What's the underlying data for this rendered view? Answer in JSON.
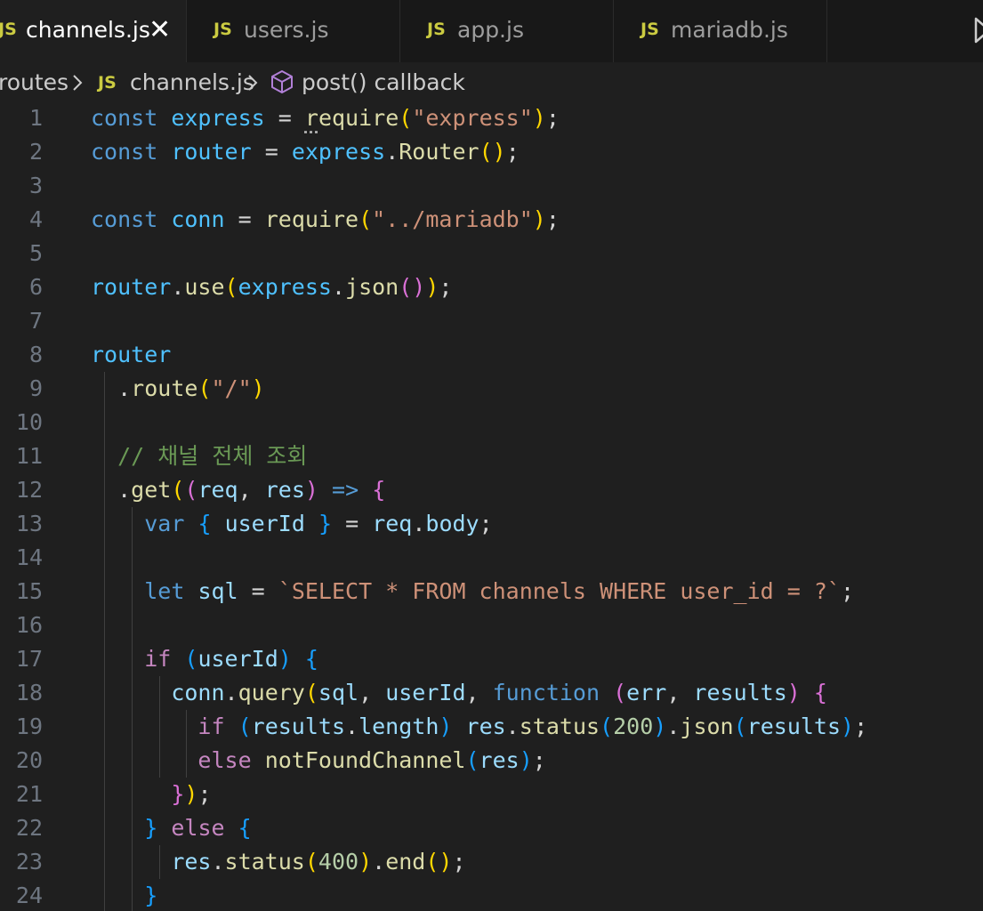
{
  "tabs": [
    {
      "icon": "JS",
      "label": "channels.js",
      "active": true,
      "close": "✕"
    },
    {
      "icon": "JS",
      "label": "users.js",
      "active": false
    },
    {
      "icon": "JS",
      "label": "app.js",
      "active": false
    },
    {
      "icon": "JS",
      "label": "mariadb.js",
      "active": false
    }
  ],
  "breadcrumb": {
    "folder": "routes",
    "file_icon": "JS",
    "file": "channels.js",
    "symbol_icon": "cube-icon",
    "symbol": "post() callback"
  },
  "line_numbers": [
    "1",
    "2",
    "3",
    "4",
    "5",
    "6",
    "7",
    "8",
    "9",
    "10",
    "11",
    "12",
    "13",
    "14",
    "15",
    "16",
    "17",
    "18",
    "19",
    "20",
    "21",
    "22",
    "23",
    "24"
  ],
  "code": {
    "l1": {
      "kw": "const",
      "v": "express",
      "eq": "=",
      "r": "r",
      "rest": "equire",
      "p1": "(",
      "s": "\"express\"",
      "p2": ")",
      "end": ";"
    },
    "l2": {
      "kw": "const",
      "v": "router",
      "eq": "=",
      "obj": "express",
      "fn": "Router",
      "p1": "(",
      "p2": ")",
      "end": ";"
    },
    "l4": {
      "kw": "const",
      "v": "conn",
      "eq": "=",
      "fn": "require",
      "p1": "(",
      "s": "\"../mariadb\"",
      "p2": ")",
      "end": ";"
    },
    "l6": {
      "obj": "router",
      "fn": "use",
      "p1": "(",
      "obj2": "express",
      "fn2": "json",
      "p3": "(",
      "p4": ")",
      "p2": ")",
      "end": ";"
    },
    "l8": {
      "obj": "router"
    },
    "l9": {
      "dot": ".",
      "fn": "route",
      "p1": "(",
      "s": "\"/\"",
      "p2": ")"
    },
    "l11": {
      "cmt": "// 채널 전체 조회"
    },
    "l12": {
      "dot": ".",
      "fn": "get",
      "p1": "(",
      "p2": "(",
      "a1": "req",
      "comma": ",",
      "a2": "res",
      "p3": ")",
      "arrow": "=>",
      "brace": "{"
    },
    "l13": {
      "kw": "var",
      "b1": "{",
      "v": "userId",
      "b2": "}",
      "eq": "=",
      "obj": "req",
      "prop": "body",
      "end": ";"
    },
    "l15": {
      "kw": "let",
      "v": "sql",
      "eq": "=",
      "s": "`SELECT * FROM channels WHERE user_id = ?`",
      "end": ";"
    },
    "l17": {
      "kw": "if",
      "p1": "(",
      "v": "userId",
      "p2": ")",
      "brace": "{"
    },
    "l18": {
      "obj": "conn",
      "fn": "query",
      "p1": "(",
      "a1": "sql",
      "a2": "userId",
      "kw": "function",
      "p2": "(",
      "a3": "err",
      "a4": "results",
      "p3": ")",
      "brace": "{"
    },
    "l19": {
      "kw": "if",
      "p1": "(",
      "obj": "results",
      "prop": "length",
      "p2": ")",
      "obj2": "res",
      "fn": "status",
      "p3": "(",
      "num": "200",
      "p4": ")",
      "fn2": "json",
      "p5": "(",
      "a": "results",
      "p6": ")",
      "end": ";"
    },
    "l20": {
      "kw": "else",
      "fn": "notFoundChannel",
      "p1": "(",
      "a": "res",
      "p2": ")",
      "end": ";"
    },
    "l21": {
      "brace": "}",
      "p": ")",
      "end": ";"
    },
    "l22": {
      "brace1": "}",
      "kw": "else",
      "brace2": "{"
    },
    "l23": {
      "obj": "res",
      "fn": "status",
      "p1": "(",
      "num": "400",
      "p2": ")",
      "fn2": "end",
      "p3": "(",
      "p4": ")",
      "end": ";"
    },
    "l24": {
      "brace": "}"
    }
  },
  "colors": {
    "editor_bg": "#1f1f1f",
    "tab_bg": "#181818",
    "js_icon": "#cbcb41",
    "keyword": "#569cd6",
    "string": "#ce9178",
    "function": "#dcdcaa",
    "comment": "#6a9955"
  }
}
